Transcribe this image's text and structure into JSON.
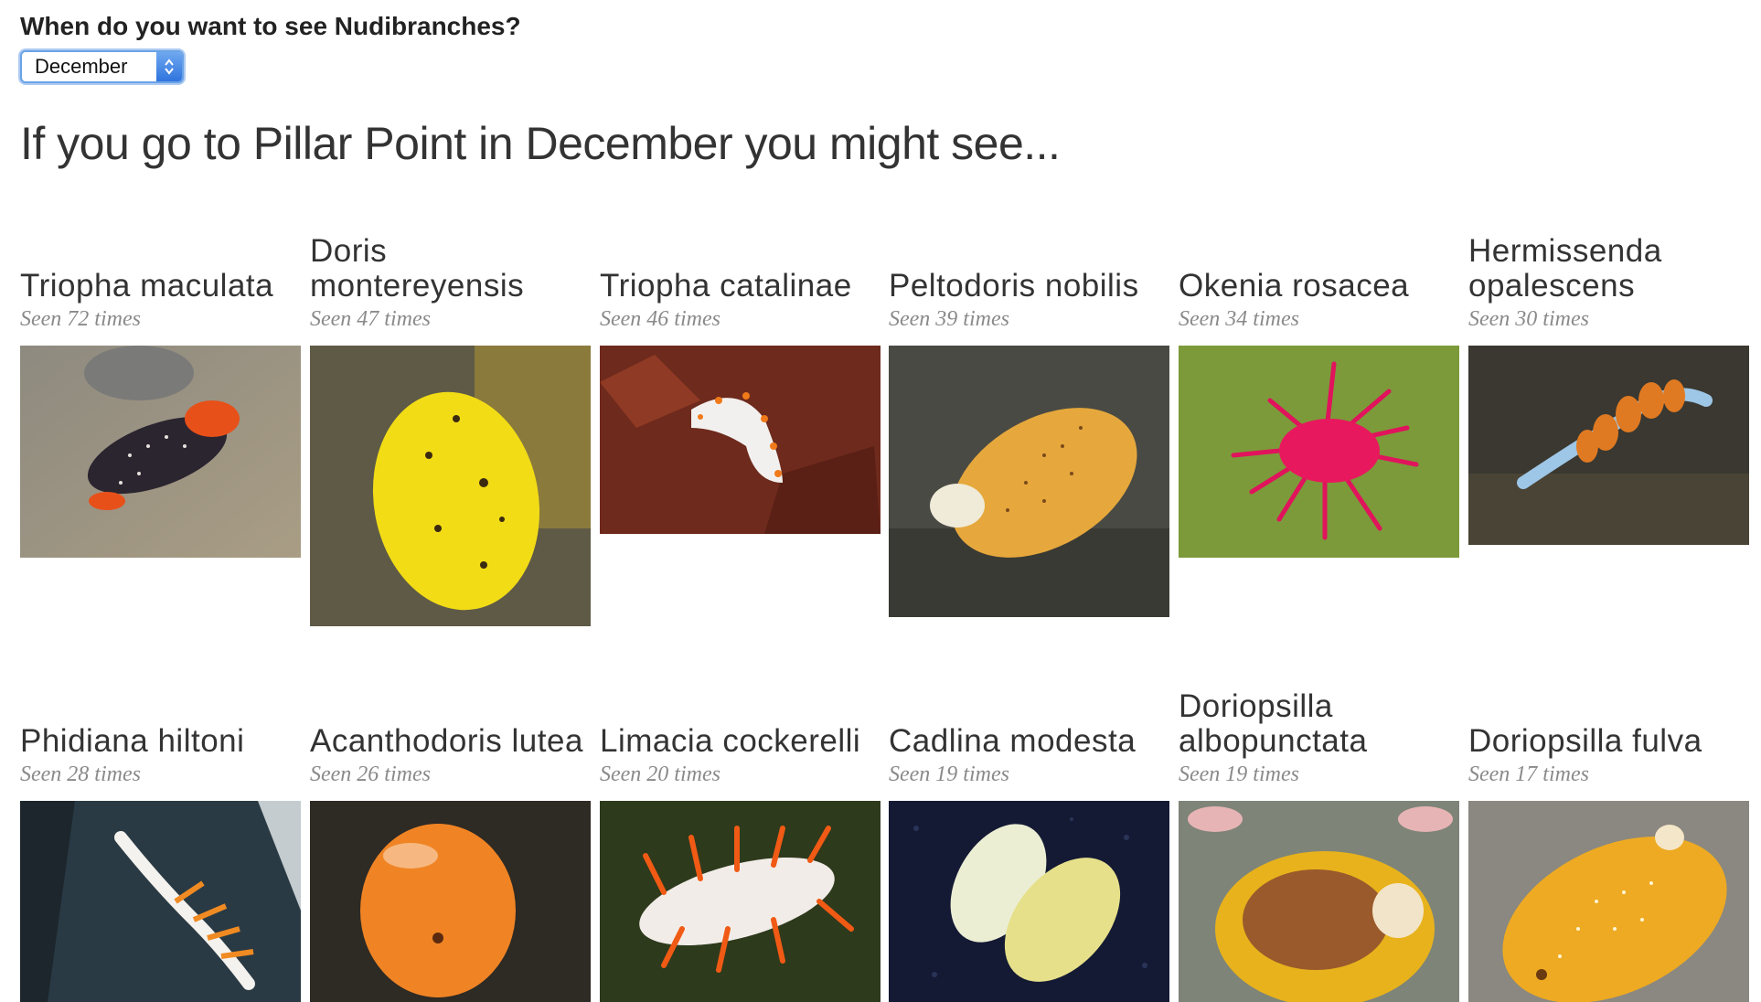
{
  "prompt": {
    "question": "When do you want to see Nudibranches?",
    "selected_month": "December"
  },
  "heading": "If you go to Pillar Point in December you might see...",
  "species": [
    {
      "name": "Triopha maculata",
      "seen": "Seen 72 times",
      "icon": "triopha-maculata-photo"
    },
    {
      "name": "Doris montereyensis",
      "seen": "Seen 47 times",
      "icon": "doris-montereyensis-photo"
    },
    {
      "name": "Triopha catalinae",
      "seen": "Seen 46 times",
      "icon": "triopha-catalinae-photo"
    },
    {
      "name": "Peltodoris nobilis",
      "seen": "Seen 39 times",
      "icon": "peltodoris-nobilis-photo"
    },
    {
      "name": "Okenia rosacea",
      "seen": "Seen 34 times",
      "icon": "okenia-rosacea-photo"
    },
    {
      "name": "Hermissenda opalescens",
      "seen": "Seen 30 times",
      "icon": "hermissenda-opalescens-photo"
    },
    {
      "name": "Phidiana hiltoni",
      "seen": "Seen 28 times",
      "icon": "phidiana-hiltoni-photo"
    },
    {
      "name": "Acanthodoris lutea",
      "seen": "Seen 26 times",
      "icon": "acanthodoris-lutea-photo"
    },
    {
      "name": "Limacia cockerelli",
      "seen": "Seen 20 times",
      "icon": "limacia-cockerelli-photo"
    },
    {
      "name": "Cadlina modesta",
      "seen": "Seen 19 times",
      "icon": "cadlina-modesta-photo"
    },
    {
      "name": "Doriopsilla albopunctata",
      "seen": "Seen 19 times",
      "icon": "doriopsilla-albopunctata-photo"
    },
    {
      "name": "Doriopsilla fulva",
      "seen": "Seen 17 times",
      "icon": "doriopsilla-fulva-photo"
    }
  ]
}
